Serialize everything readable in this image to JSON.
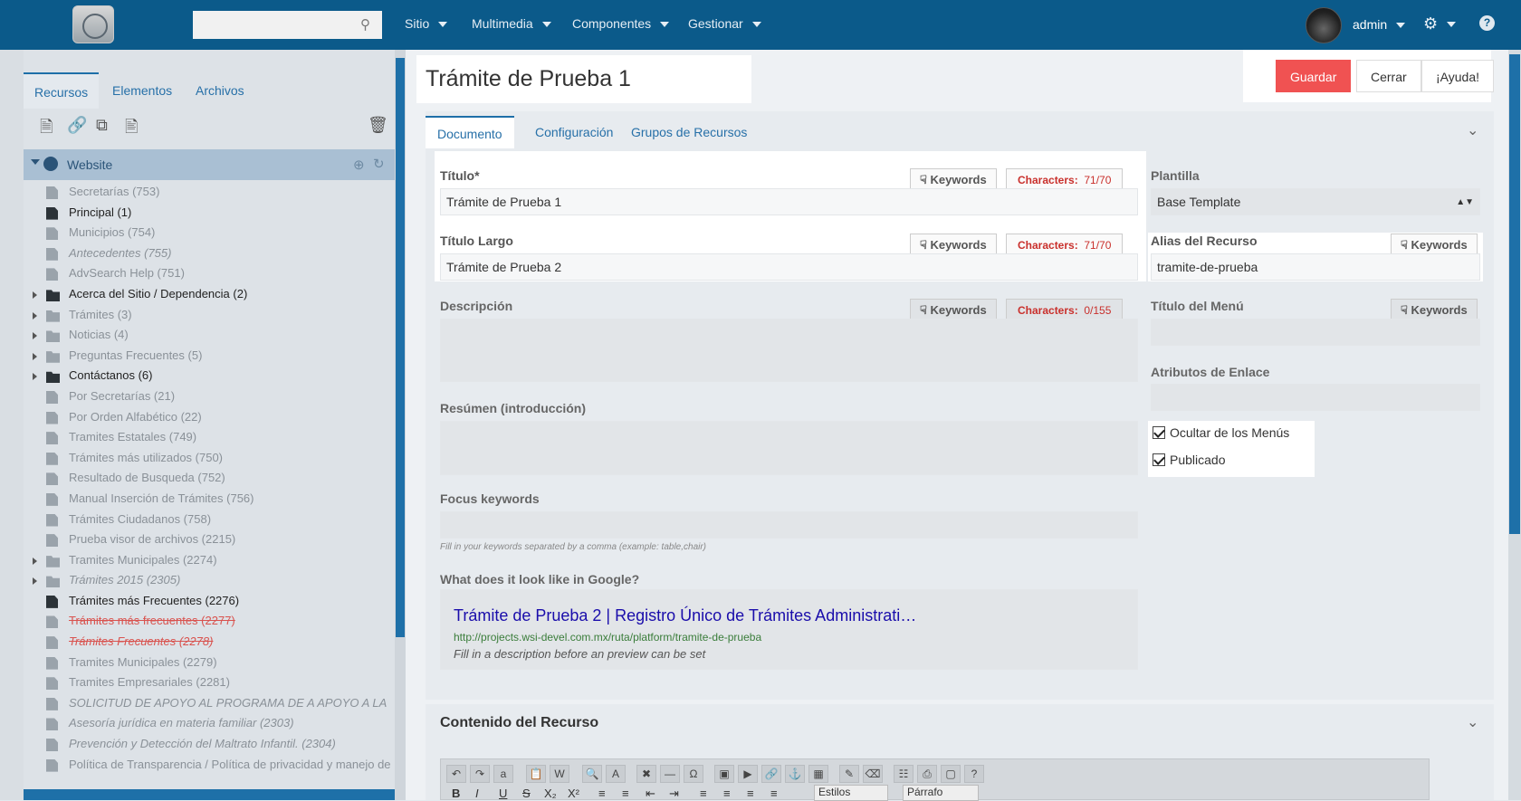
{
  "topbar": {
    "nav": [
      "Sitio",
      "Multimedia",
      "Componentes",
      "Gestionar"
    ],
    "user": "admin"
  },
  "sidebar": {
    "tabs": [
      "Recursos",
      "Elementos",
      "Archivos"
    ],
    "root": "Website",
    "items": [
      {
        "label": "Secretarías (753)",
        "kind": "doc",
        "style": "grey",
        "arrow": false
      },
      {
        "label": "Principal (1)",
        "kind": "doc",
        "style": "dark",
        "arrow": false
      },
      {
        "label": "Municipios (754)",
        "kind": "doc",
        "style": "grey",
        "arrow": false
      },
      {
        "label": "Antecedentes (755)",
        "kind": "doc",
        "style": "italic",
        "arrow": false
      },
      {
        "label": "AdvSearch Help (751)",
        "kind": "doc",
        "style": "grey",
        "arrow": false
      },
      {
        "label": "Acerca del Sitio / Dependencia (2)",
        "kind": "folder",
        "style": "dark",
        "arrow": true
      },
      {
        "label": "Trámites (3)",
        "kind": "folder",
        "style": "grey",
        "arrow": true
      },
      {
        "label": "Noticias (4)",
        "kind": "folder",
        "style": "grey",
        "arrow": true
      },
      {
        "label": "Preguntas Frecuentes (5)",
        "kind": "folder",
        "style": "grey",
        "arrow": true
      },
      {
        "label": "Contáctanos (6)",
        "kind": "folder",
        "style": "dark",
        "arrow": true
      },
      {
        "label": "Por Secretarías (21)",
        "kind": "doc",
        "style": "grey",
        "arrow": false
      },
      {
        "label": "Por Orden Alfabético (22)",
        "kind": "doc",
        "style": "grey",
        "arrow": false
      },
      {
        "label": "Tramites Estatales (749)",
        "kind": "doc",
        "style": "grey",
        "arrow": false
      },
      {
        "label": "Trámites más utilizados (750)",
        "kind": "doc",
        "style": "grey",
        "arrow": false
      },
      {
        "label": "Resultado de Busqueda (752)",
        "kind": "doc",
        "style": "grey",
        "arrow": false
      },
      {
        "label": "Manual Inserción de Trámites (756)",
        "kind": "doc",
        "style": "grey",
        "arrow": false
      },
      {
        "label": "Trámites Ciudadanos (758)",
        "kind": "doc",
        "style": "grey",
        "arrow": false
      },
      {
        "label": "Prueba visor de archivos (2215)",
        "kind": "doc",
        "style": "grey",
        "arrow": false
      },
      {
        "label": "Tramites Municipales (2274)",
        "kind": "folder",
        "style": "grey",
        "arrow": true
      },
      {
        "label": "Trámites 2015 (2305)",
        "kind": "folder",
        "style": "italic",
        "arrow": true
      },
      {
        "label": "Trámites más Frecuentes (2276)",
        "kind": "doc",
        "style": "dark",
        "arrow": false
      },
      {
        "label": "Trámites más frecuentes (2277)",
        "kind": "doc",
        "style": "red",
        "arrow": false
      },
      {
        "label": "Trámites Frecuentes (2278)",
        "kind": "doc",
        "style": "redi",
        "arrow": false
      },
      {
        "label": "Tramites Municipales (2279)",
        "kind": "doc",
        "style": "grey",
        "arrow": false
      },
      {
        "label": "Tramites Empresariales (2281)",
        "kind": "doc",
        "style": "grey",
        "arrow": false
      },
      {
        "label": "SOLICITUD DE APOYO AL PROGRAMA DE A APOYO A LA",
        "kind": "doc",
        "style": "italic",
        "arrow": false
      },
      {
        "label": "Asesoría jurídica en materia familiar (2303)",
        "kind": "doc",
        "style": "italic",
        "arrow": false
      },
      {
        "label": "Prevención y Detección del Maltrato Infantil. (2304)",
        "kind": "doc",
        "style": "italic",
        "arrow": false
      },
      {
        "label": "Política de Transparencia / Política de privacidad y manejo de",
        "kind": "doc",
        "style": "grey",
        "arrow": false
      }
    ]
  },
  "header": {
    "title": "Trámite de Prueba 1",
    "save": "Guardar",
    "close": "Cerrar",
    "help": "¡Ayuda!"
  },
  "tabs": [
    "Documento",
    "Configuración",
    "Grupos de Recursos"
  ],
  "form": {
    "keywords": "Keywords",
    "chars_label": "Characters:",
    "titulo": {
      "label": "Título*",
      "value": "Trámite de Prueba 1",
      "count": "71/70"
    },
    "titulo_largo": {
      "label": "Título Largo",
      "value": "Trámite de Prueba 2",
      "count": "71/70"
    },
    "descripcion": {
      "label": "Descripción",
      "count": "0/155"
    },
    "resumen": {
      "label": "Resúmen (introducción)"
    },
    "focus": {
      "label": "Focus keywords",
      "hint": "Fill in your keywords separated by a comma (example: table,chair)"
    },
    "google": {
      "label": "What does it look like in Google?",
      "title": "Trámite de Prueba 2 | Registro Único de Trámites Administrati…",
      "url": "http://projects.wsi-devel.com.mx/ruta/platform/tramite-de-prueba",
      "desc": "Fill in a description before an preview can be set"
    },
    "plantilla": {
      "label": "Plantilla",
      "value": "Base Template"
    },
    "alias": {
      "label": "Alias del Recurso",
      "value": "tramite-de-prueba"
    },
    "menu_title": {
      "label": "Título del Menú"
    },
    "link_attrs": {
      "label": "Atributos de Enlace"
    },
    "hide_menus": "Ocultar de los Menús",
    "published": "Publicado"
  },
  "content": {
    "title": "Contenido del Recurso",
    "styles": "Estilos",
    "paragraph": "Párrafo"
  }
}
